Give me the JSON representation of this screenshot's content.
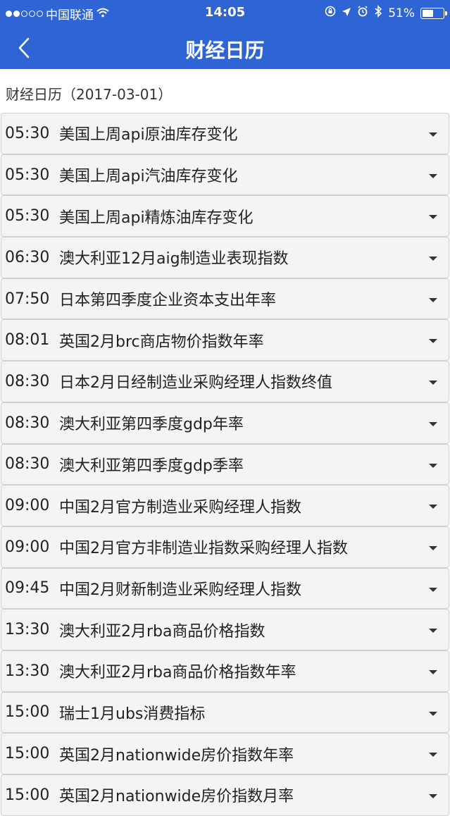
{
  "status": {
    "carrier": "中国联通",
    "time": "14:05",
    "battery": "51%"
  },
  "nav": {
    "title": "财经日历"
  },
  "subheading": "财经日历（2017-03-01）",
  "events": [
    {
      "time": "05:30",
      "label": "美国上周api原油库存变化"
    },
    {
      "time": "05:30",
      "label": "美国上周api汽油库存变化"
    },
    {
      "time": "05:30",
      "label": "美国上周api精炼油库存变化"
    },
    {
      "time": "06:30",
      "label": "澳大利亚12月aig制造业表现指数"
    },
    {
      "time": "07:50",
      "label": "日本第四季度企业资本支出年率"
    },
    {
      "time": "08:01",
      "label": "英国2月brc商店物价指数年率"
    },
    {
      "time": "08:30",
      "label": "日本2月日经制造业采购经理人指数终值"
    },
    {
      "time": "08:30",
      "label": "澳大利亚第四季度gdp年率"
    },
    {
      "time": "08:30",
      "label": "澳大利亚第四季度gdp季率"
    },
    {
      "time": "09:00",
      "label": "中国2月官方制造业采购经理人指数"
    },
    {
      "time": "09:00",
      "label": "中国2月官方非制造业指数采购经理人指数"
    },
    {
      "time": "09:45",
      "label": "中国2月财新制造业采购经理人指数"
    },
    {
      "time": "13:30",
      "label": "澳大利亚2月rba商品价格指数"
    },
    {
      "time": "13:30",
      "label": "澳大利亚2月rba商品价格指数年率"
    },
    {
      "time": "15:00",
      "label": "瑞士1月ubs消费指标"
    },
    {
      "time": "15:00",
      "label": "英国2月nationwide房价指数年率"
    },
    {
      "time": "15:00",
      "label": "英国2月nationwide房价指数月率"
    }
  ]
}
